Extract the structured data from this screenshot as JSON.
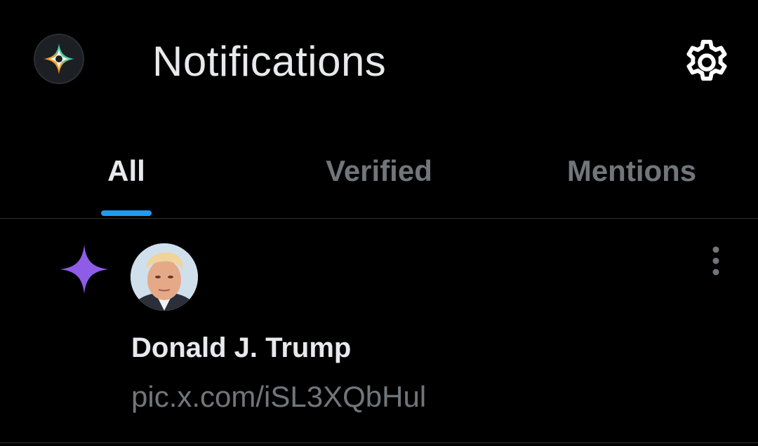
{
  "header": {
    "logo_icon": "app-logo-star-icon",
    "title": "Notifications",
    "settings_icon": "gear-icon"
  },
  "tabs": [
    {
      "label": "All",
      "active": true
    },
    {
      "label": "Verified",
      "active": false
    },
    {
      "label": "Mentions",
      "active": false
    }
  ],
  "notification": {
    "type_icon": "sparkle-star-icon",
    "author": "Donald J. Trump",
    "content": "pic.x.com/iSL3XQbHul",
    "menu_icon": "more-vertical-icon"
  },
  "colors": {
    "background": "#000000",
    "text_primary": "#e7e9ea",
    "text_secondary": "#71767b",
    "accent": "#1d9bf0",
    "star": "#8f5ce8",
    "divider": "#2f3336"
  }
}
